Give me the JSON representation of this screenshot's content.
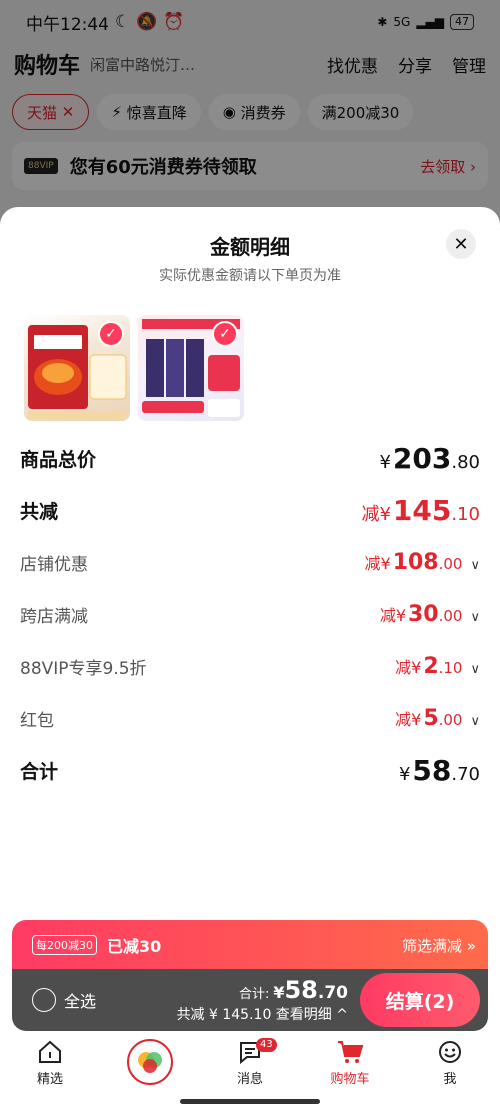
{
  "status": {
    "time": "中午12:44",
    "battery": "47",
    "network": "5G"
  },
  "header": {
    "title": "购物车",
    "address": "闲富中路悦汀…",
    "actions": [
      "找优惠",
      "分享",
      "管理"
    ]
  },
  "filters": [
    "天猫",
    "惊喜直降",
    "消费券",
    "满200减30"
  ],
  "coupon_banner": {
    "badge": "88VIP",
    "text": "您有60元消费券待领取",
    "link": "去领取 ›"
  },
  "sheet": {
    "title": "金额明细",
    "subtitle": "实际优惠金额请以下单页为准",
    "rows": [
      {
        "label": "商品总价",
        "prefix": "¥",
        "int": "203",
        "dec": ".80"
      },
      {
        "label": "共减",
        "prefix": "减¥",
        "int": "145",
        "dec": ".10"
      },
      {
        "label": "店铺优惠",
        "prefix": "减¥",
        "int": "108",
        "dec": ".00"
      },
      {
        "label": "跨店满减",
        "prefix": "减¥",
        "int": "30",
        "dec": ".00"
      },
      {
        "label": "88VIP专享9.5折",
        "prefix": "减¥",
        "int": "2",
        "dec": ".10"
      },
      {
        "label": "红包",
        "prefix": "减¥",
        "int": "5",
        "dec": ".00"
      },
      {
        "label": "合计",
        "prefix": "¥",
        "int": "58",
        "dec": ".70"
      }
    ]
  },
  "promo": {
    "tag": "每200减30",
    "text": "已减30",
    "link": "筛选满减 »"
  },
  "checkout": {
    "select_all": "全选",
    "total_label": "合计:",
    "total_prefix": "¥",
    "total_int": "58",
    "total_dec": ".70",
    "reduced": "共减 ¥ 145.10 查看明细 ^",
    "pay_button": "结算(2)"
  },
  "tabs": [
    {
      "label": "精选",
      "icon": "home-icon"
    },
    {
      "label": "",
      "icon": "app-logo-icon"
    },
    {
      "label": "消息",
      "icon": "message-icon",
      "badge": "43"
    },
    {
      "label": "购物车",
      "icon": "cart-icon"
    },
    {
      "label": "我",
      "icon": "profile-icon"
    }
  ],
  "colors": {
    "accent": "#e0262f",
    "pay": "#ff3a62"
  }
}
